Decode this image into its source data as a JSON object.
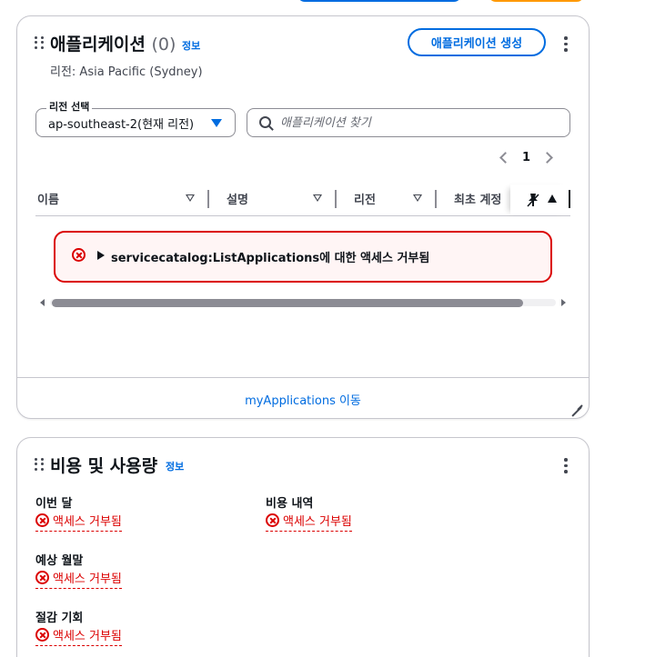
{
  "applications_widget": {
    "title": "애플리케이션",
    "count": "(0)",
    "info": "정보",
    "create_button": "애플리케이션 생성",
    "subtitle": "리전: Asia Pacific (Sydney)",
    "region_select": {
      "label": "리전 선택",
      "value": "ap-southeast-2(현재 리전)"
    },
    "search": {
      "placeholder": "애플리케이션 찾기"
    },
    "pagination": {
      "current_page": "1"
    },
    "table": {
      "columns": [
        "이름",
        "설명",
        "리전",
        "최초 계정"
      ]
    },
    "error": {
      "code": "servicecatalog:ListApplications",
      "message": "에 대한 액세스 거부됨"
    },
    "footer_link": "myApplications 이동"
  },
  "cost_widget": {
    "title": "비용 및 사용량",
    "info": "정보",
    "metrics": [
      {
        "label": "이번 달",
        "value": "액세스 거부됨"
      },
      {
        "label": "비용 내역",
        "value": "액세스 거부됨"
      },
      {
        "label": "예상 월말",
        "value": "액세스 거부됨"
      },
      {
        "label": "절감 기회",
        "value": "액세스 거부됨"
      }
    ]
  },
  "colors": {
    "accent": "#006ce0",
    "error": "#db0000",
    "border": "#c6c6cd",
    "text": "#0f141a"
  }
}
